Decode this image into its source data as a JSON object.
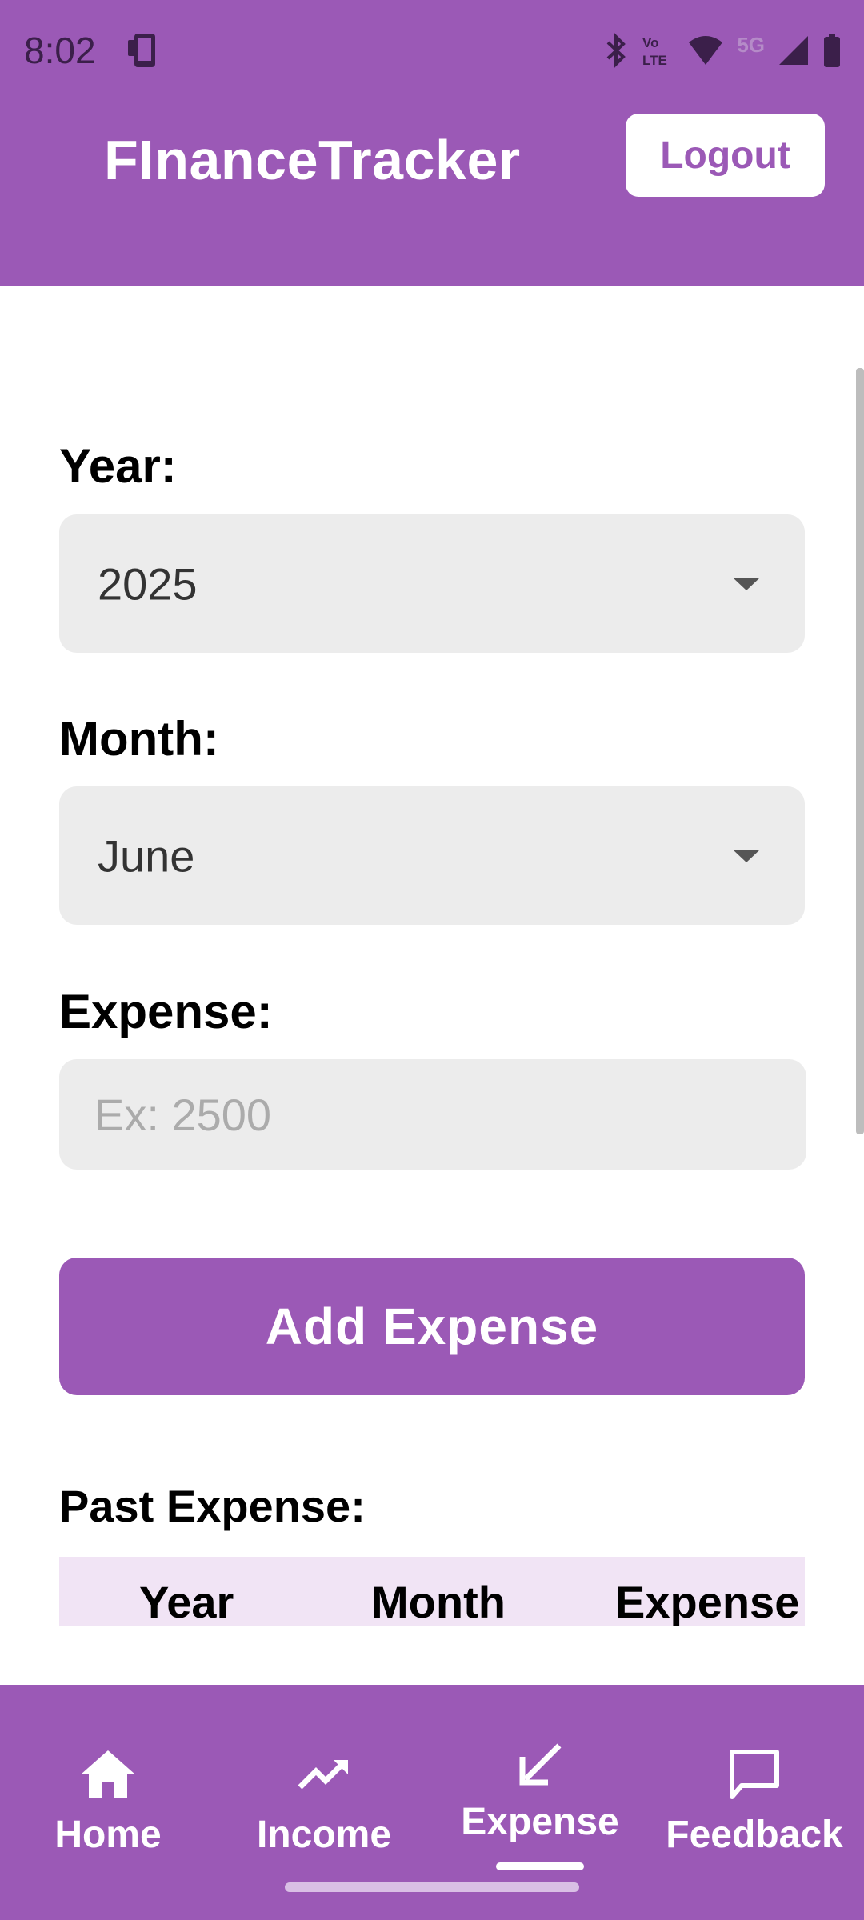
{
  "status_bar": {
    "time": "8:02",
    "network_label": "5G",
    "icons": [
      "phone-icon",
      "bluetooth-icon",
      "volte-icon",
      "wifi-icon",
      "signal-icon",
      "battery-icon"
    ]
  },
  "header": {
    "title": "FInanceTracker",
    "logout_label": "Logout"
  },
  "form": {
    "year_label": "Year:",
    "year_value": "2025",
    "month_label": "Month:",
    "month_value": "June",
    "expense_label": "Expense:",
    "expense_placeholder": "Ex: 2500",
    "expense_value": "",
    "add_button_label": "Add Expense"
  },
  "past_expense": {
    "title": "Past Expense:",
    "columns": [
      "Year",
      "Month",
      "Expense"
    ]
  },
  "bottom_nav": {
    "active": "Expense",
    "items": [
      {
        "label": "Home",
        "icon": "home-icon"
      },
      {
        "label": "Income",
        "icon": "trending-up-icon"
      },
      {
        "label": "Expense",
        "icon": "arrow-down-left-icon"
      },
      {
        "label": "Feedback",
        "icon": "chat-bubble-icon"
      }
    ]
  },
  "colors": {
    "primary": "#9b59b6",
    "field_bg": "#ececec",
    "table_header_bg": "#f1e4f5",
    "white": "#ffffff"
  }
}
